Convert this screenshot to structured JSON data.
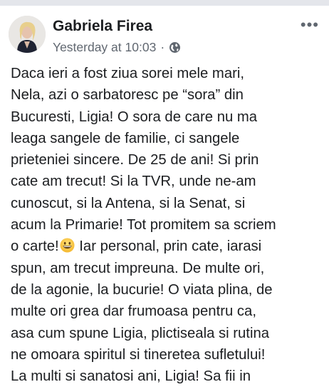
{
  "post": {
    "author": "Gabriela Firea",
    "timestamp": "Yesterday at 10:03",
    "separator": "·",
    "audience_icon": "globe-icon",
    "more_icon": "more-options-icon",
    "more_label": "•••",
    "body_lines": [
      "Daca ieri a fost ziua sorei mele mari,",
      "Nela, azi o sarbatoresc pe “sora” din",
      "Bucuresti, Ligia! O sora de care nu ma",
      "leaga sangele de familie, ci sangele",
      "prieteniei sincere. De 25 de ani! Si prin",
      "cate am trecut! Si la TVR, unde ne-am",
      "cunoscut, si la Antena, si la Senat, si",
      "acum la Primarie! Tot promitem sa scriem",
      {
        "before_emoji": "o carte!",
        "emoji": "grinning-face-emoji",
        "after_emoji": " Iar personal, prin cate, iarasi"
      },
      "spun, am trecut impreuna. De multe ori,",
      "de la agonie, la bucurie! O viata plina, de",
      "multe ori grea dar frumoasa pentru ca,",
      "asa cum spune Ligia, plictiseala si rutina",
      "ne omoara spiritul si tineretea sufletului!",
      "La multi si sanatosi ani, Ligia! Sa fii in"
    ]
  }
}
